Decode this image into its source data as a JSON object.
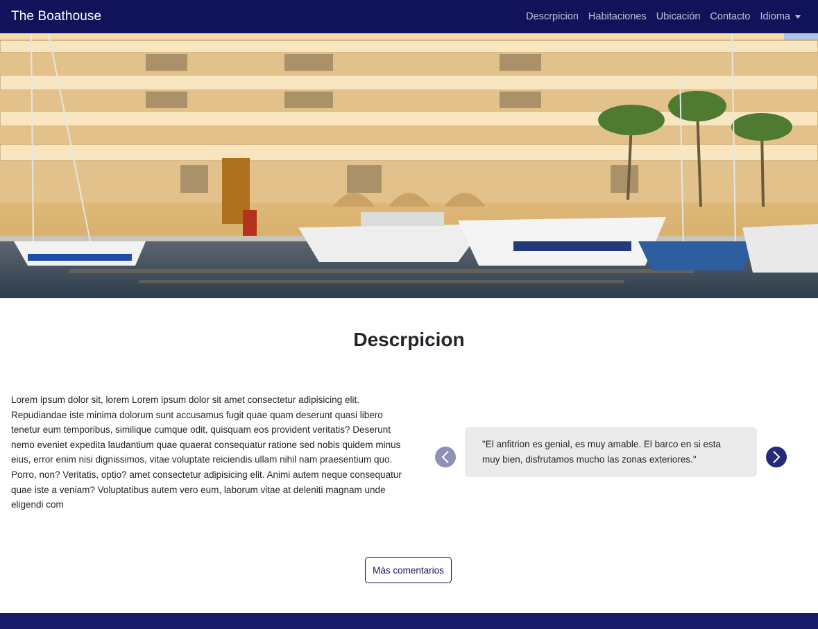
{
  "navbar": {
    "brand": "The Boathouse",
    "links": [
      {
        "label": "Descrpicion"
      },
      {
        "label": "Habitaciones"
      },
      {
        "label": "Ubicación"
      },
      {
        "label": "Contacto"
      },
      {
        "label": "Idioma"
      }
    ]
  },
  "hero": {
    "image": "marina-hotel-with-boats-photo"
  },
  "description": {
    "title": "Descrpicion",
    "body": "Lorem ipsum dolor sit, lorem Lorem ipsum dolor sit amet consectetur adipisicing elit. Repudiandae iste minima dolorum sunt accusamus fugit quae quam deserunt quasi libero tenetur eum temporibus, similique cumque odit, quisquam eos provident veritatis? Deserunt nemo eveniet expedita laudantium quae quaerat consequatur ratione sed nobis quidem minus eius, error enim nisi dignissimos, vitae voluptate reiciendis ullam nihil nam praesentium quo. Porro, non? Veritatis, optio? amet consectetur adipisicing elit. Animi autem neque consequatur quae iste a veniam? Voluptatibus autem vero eum, laborum vitae at deleniti magnam unde eligendi com"
  },
  "testimonials": {
    "current": "\"El anfitrion es genial, es muy amable. El barco en si esta muy bien, disfrutamos mucho las zonas exteriores.\"",
    "prev_icon": "chevron-left-icon",
    "next_icon": "chevron-right-icon",
    "more_label": "Más comentarios"
  },
  "colors": {
    "navbar_bg": "#11135a",
    "footer_bg": "#191b6b",
    "accent": "#252a7a"
  }
}
